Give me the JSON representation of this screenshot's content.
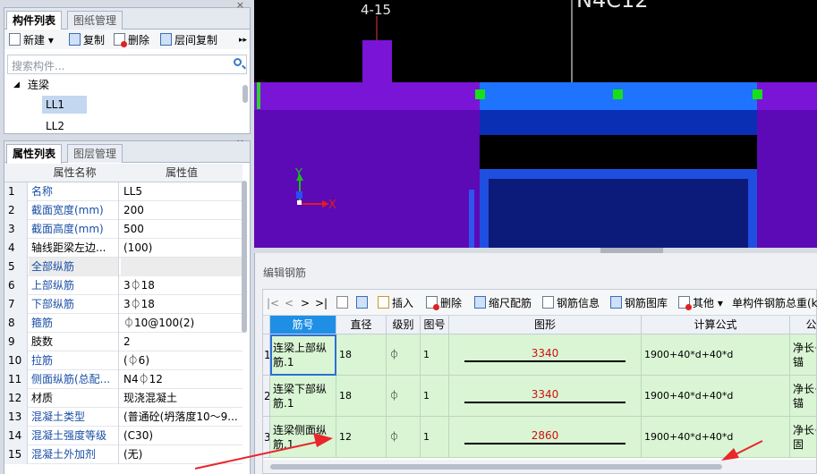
{
  "component_panel": {
    "tabs": [
      "构件列表",
      "图纸管理"
    ],
    "toolbar": {
      "new": "新建",
      "copy": "复制",
      "delete": "删除",
      "floor_copy": "层间复制"
    },
    "search_placeholder": "搜索构件...",
    "tree": {
      "group": "连梁",
      "items": [
        "LL1",
        "LL2"
      ]
    }
  },
  "property_panel": {
    "tabs": [
      "属性列表",
      "图层管理"
    ],
    "headers": {
      "name": "属性名称",
      "value": "属性值"
    },
    "rows": [
      {
        "num": "1",
        "name": "名称",
        "value": "LL5"
      },
      {
        "num": "2",
        "name": "截面宽度(mm)",
        "value": "200"
      },
      {
        "num": "3",
        "name": "截面高度(mm)",
        "value": "500"
      },
      {
        "num": "4",
        "name": "轴线距梁左边...",
        "value": "(100)"
      },
      {
        "num": "5",
        "name": "全部纵筋",
        "value": ""
      },
      {
        "num": "6",
        "name": "上部纵筋",
        "value": "3⏀18"
      },
      {
        "num": "7",
        "name": "下部纵筋",
        "value": "3⏀18"
      },
      {
        "num": "8",
        "name": "箍筋",
        "value": "⏀10@100(2)"
      },
      {
        "num": "9",
        "name": "肢数",
        "value": "2"
      },
      {
        "num": "10",
        "name": "拉筋",
        "value": "(⏀6)"
      },
      {
        "num": "11",
        "name": "侧面纵筋(总配...",
        "value": "N4⏀12"
      },
      {
        "num": "12",
        "name": "材质",
        "value": "现浇混凝土"
      },
      {
        "num": "13",
        "name": "混凝土类型",
        "value": "(普通砼(坍落度10～9..."
      },
      {
        "num": "14",
        "name": "混凝土强度等级",
        "value": "(C30)"
      },
      {
        "num": "15",
        "name": "混凝土外加剂",
        "value": "(无)"
      }
    ]
  },
  "cad": {
    "labels": {
      "top_left": "4-15",
      "top_right": "N4C12"
    },
    "axis": {
      "y": "Y",
      "x": "X"
    }
  },
  "rebar_editor": {
    "title": "编辑钢筋",
    "toolbar": {
      "nav": [
        "|<",
        "<",
        ">",
        ">|"
      ],
      "insert": "插入",
      "delete": "删除",
      "scale": "缩尺配筋",
      "info": "钢筋信息",
      "library": "钢筋图库",
      "other": "其他",
      "total_weight": "单构件钢筋总重(kg"
    },
    "headers": [
      "筋号",
      "直径(mm)",
      "级别",
      "图号",
      "图形",
      "计算公式",
      "公式"
    ],
    "rows": [
      {
        "idx": "1",
        "name": "连梁上部纵筋.1",
        "dia": "18",
        "grade": "⏀",
        "fig": "1",
        "shape": "3340",
        "formula": "1900+40*d+40*d",
        "desc": "净长+直锚"
      },
      {
        "idx": "2",
        "name": "连梁下部纵筋.1",
        "dia": "18",
        "grade": "⏀",
        "fig": "1",
        "shape": "3340",
        "formula": "1900+40*d+40*d",
        "desc": "净长+直锚"
      },
      {
        "idx": "3",
        "name": "连梁侧面纵筋.1",
        "dia": "12",
        "grade": "⏀",
        "fig": "1",
        "shape": "2860",
        "formula": "1900+40*d+40*d",
        "desc": "净长+锚固"
      }
    ]
  },
  "colors": {
    "cad_bg": "#000000",
    "purple": "#6b00c8",
    "blue": "#1e73ff",
    "green_row": "#d9f5d4",
    "arrow_red": "#e8262c"
  }
}
